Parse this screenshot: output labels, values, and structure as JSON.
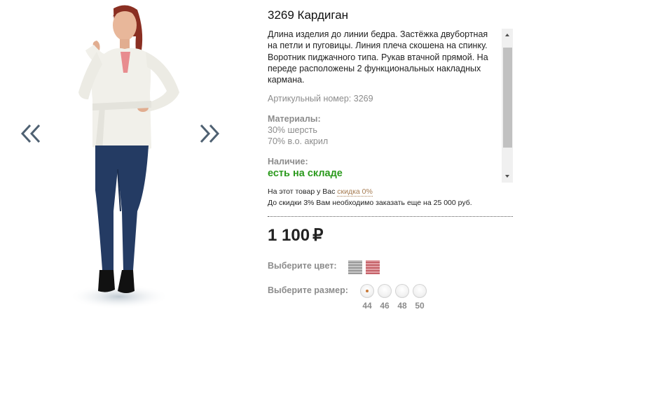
{
  "nav": {
    "prev_icon": "double-chevron-left-icon",
    "next_icon": "double-chevron-right-icon"
  },
  "product": {
    "title": "3269 Кардиган",
    "description": "Длина изделия до линии бедра. Застёжка двубортная на петли и пуговицы. Линия плеча скошена на спинку. Воротник пиджачного типа. Рукав втачной прямой. На переде расположены 2 функциональных накладных кармана.",
    "sku": "Артикульный номер: 3269",
    "materials_label": "Материалы:",
    "materials": [
      "30% шерсть",
      "70% в.о. акрил"
    ],
    "availability_label": "Наличие:",
    "availability_value": "есть на складе",
    "discount_text": "На этот товар у Вас",
    "discount_link": "скидка 0%",
    "discount_next": "До скидки 3% Вам необходимо заказать еще на 25 000 руб.",
    "price": "1 100",
    "currency": "₽",
    "color_label": "Выберите цвет:",
    "colors": [
      {
        "name": "gray",
        "hex": "#a8a8a8"
      },
      {
        "name": "pink",
        "hex": "#d37f86"
      }
    ],
    "size_label": "Выберите размер:",
    "sizes": [
      "44",
      "46",
      "48",
      "50"
    ],
    "selected_size": "44"
  },
  "colors": {
    "accent_green": "#2b9a1d",
    "link_brown": "#a67c52",
    "label_gray": "#8c8c8c"
  }
}
